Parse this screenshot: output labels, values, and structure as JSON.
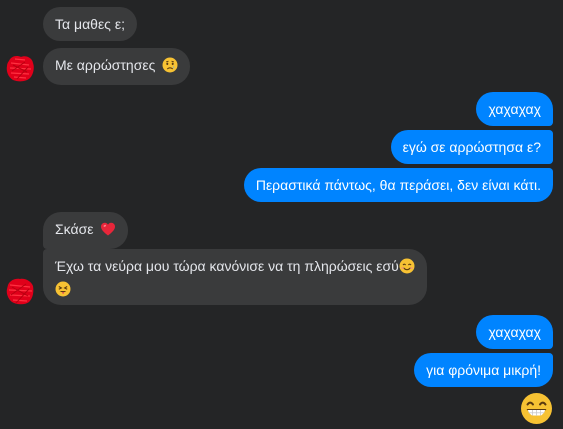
{
  "conversation": {
    "messages": [
      {
        "id": "m1",
        "side": "incoming",
        "text": "Τα μαθες ε;"
      },
      {
        "id": "m2",
        "side": "incoming",
        "text": "Με αρρώστησες",
        "emoji": "sad-face"
      },
      {
        "id": "m3",
        "side": "outgoing",
        "text": "χαχαχαχ"
      },
      {
        "id": "m4",
        "side": "outgoing",
        "text": "εγώ σε αρρώστησα ε?"
      },
      {
        "id": "m5",
        "side": "outgoing",
        "text": "Περαστικά πάντως, θα περάσει, δεν είναι κάτι."
      },
      {
        "id": "m6",
        "side": "incoming",
        "text": "Σκάσε",
        "emoji": "red-heart"
      },
      {
        "id": "m7",
        "side": "incoming",
        "text": "Έχω τα νεύρα μου τώρα κανόνισε να τη πληρώσεις εσύ",
        "emoji": "smiling-face",
        "emoji2": "tongue-out-face"
      },
      {
        "id": "m8",
        "side": "outgoing",
        "text": "χαχαχαχ"
      },
      {
        "id": "m9",
        "side": "outgoing",
        "text": "για φρόνιμα μικρή!"
      }
    ],
    "reaction_emoji": "grinning-face",
    "avatar_icon": "redacted-avatar",
    "colors": {
      "background": "#242526",
      "incoming_bubble": "#3a3b3c",
      "outgoing_bubble": "#0084ff",
      "redaction": "#e0001a"
    }
  }
}
